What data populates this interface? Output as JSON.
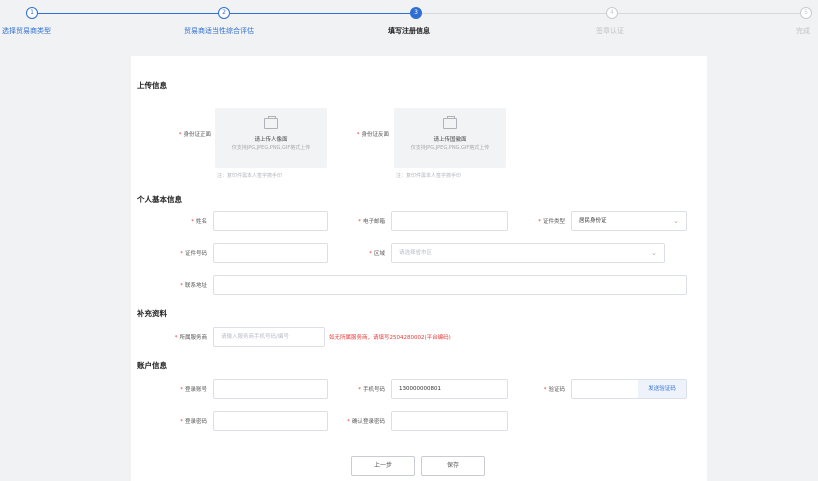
{
  "steps": [
    {
      "num": "1",
      "label": "选择贸易商类型",
      "state": "done"
    },
    {
      "num": "2",
      "label": "贸易商适当性综合评估",
      "state": "done"
    },
    {
      "num": "3",
      "label": "填写注册信息",
      "state": "current"
    },
    {
      "num": "4",
      "label": "签章认证",
      "state": "todo"
    },
    {
      "num": "5",
      "label": "完成",
      "state": "todo"
    }
  ],
  "upload_section": {
    "title": "上传信息",
    "front": {
      "label": "身份证正面",
      "hint": "请上传人像面",
      "formats": "仅支持JPG,JPEG,PNG,GIF格式上传",
      "note": "注：复印件需本人签字捺手印"
    },
    "back": {
      "label": "身份证反面",
      "hint": "请上传国徽面",
      "formats": "仅支持JPG,JPEG,PNG,GIF格式上传",
      "note": "注：复印件需本人签字捺手印"
    }
  },
  "personal": {
    "title": "个人基本信息",
    "name_label": "姓名",
    "email_label": "电子邮箱",
    "id_type_label": "证件类型",
    "id_type_value": "居民身份证",
    "id_number_label": "证件号码",
    "region_label": "区域",
    "region_placeholder": "请选择省市区",
    "address_label": "联系地址"
  },
  "supplement": {
    "title": "补充资料",
    "service_label": "所属服务商",
    "service_placeholder": "请输入服务商手机号码/编号",
    "warning": "如无所属服务商，请填写2504280002(平台编码)"
  },
  "account": {
    "title": "账户信息",
    "login_label": "登录账号",
    "phone_label": "手机号码",
    "phone_value": "130000000801",
    "code_label": "验证码",
    "send_code": "发送验证码",
    "password_label": "登录密码",
    "confirm_label": "确认登录密码"
  },
  "buttons": {
    "prev": "上一步",
    "save": "保存"
  },
  "colors": {
    "primary": "#2f6fd4",
    "required": "#e53935"
  }
}
